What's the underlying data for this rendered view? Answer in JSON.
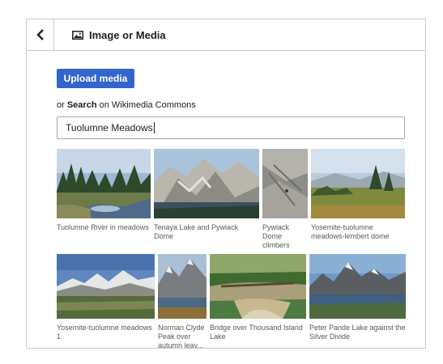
{
  "dialog": {
    "title": "Image or Media",
    "upload_label": "Upload media",
    "or_text": "or ",
    "search_bold": "Search",
    "on_text": " on Wikimedia Commons",
    "search_value": "Tuolumne Meadows"
  },
  "results": [
    {
      "caption": "Tuolumne River in meadows",
      "icon": "river-forest-photo"
    },
    {
      "caption": "Tenaya Lake and Pywiack Dome",
      "icon": "granite-mountains-photo"
    },
    {
      "caption": "Pywiack Dome climbers",
      "icon": "granite-slab-photo"
    },
    {
      "caption": "Yosemite-tuolumne meadows-lembert dome",
      "icon": "meadow-trees-photo"
    },
    {
      "caption": "Yosemite-tuolumne meadows 1",
      "icon": "snowy-peaks-photo"
    },
    {
      "caption": "Norman Clyde Peak over autumn leav...",
      "icon": "peak-lake-photo"
    },
    {
      "caption": "Bridge over Thousand Island Lake",
      "icon": "bridge-lake-photo"
    },
    {
      "caption": "Peter Pande Lake against the Silver Divide",
      "icon": "alpine-lake-photo"
    }
  ]
}
